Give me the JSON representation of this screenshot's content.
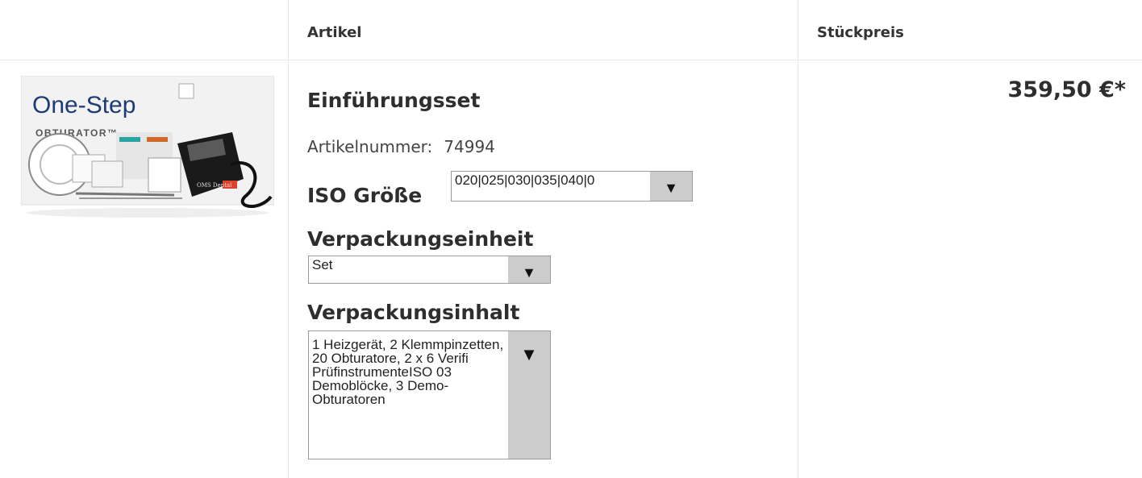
{
  "table": {
    "headers": {
      "article": "Artikel",
      "unit_price": "Stückpreis"
    }
  },
  "product": {
    "title": "Einführungsset",
    "article_number_label": "Artikelnummer:",
    "article_number": "74994",
    "options": {
      "iso_size": {
        "label": "ISO Größe",
        "value": "020|025|030|035|040|0"
      },
      "packaging_unit": {
        "label": "Verpackungseinheit",
        "value": "Set"
      },
      "packaging_content": {
        "label": "Verpackungsinhalt",
        "value": "1 Heizgerät, 2 Klemmpinzetten, 20 Obturatore, 2 x 6 Verifi PrüfinstrumenteISO 03 Demoblöcke, 3 Demo-Obturatoren"
      }
    },
    "price": "359,50 €*",
    "image": {
      "brand": "One-Step",
      "subbrand": "OBTURATOR™",
      "device_label": "OMS Dental"
    }
  },
  "icons": {
    "dropdown": "▼"
  },
  "colors": {
    "border": "#e9e9e9",
    "select_button": "#cccccc",
    "text": "#333333"
  }
}
